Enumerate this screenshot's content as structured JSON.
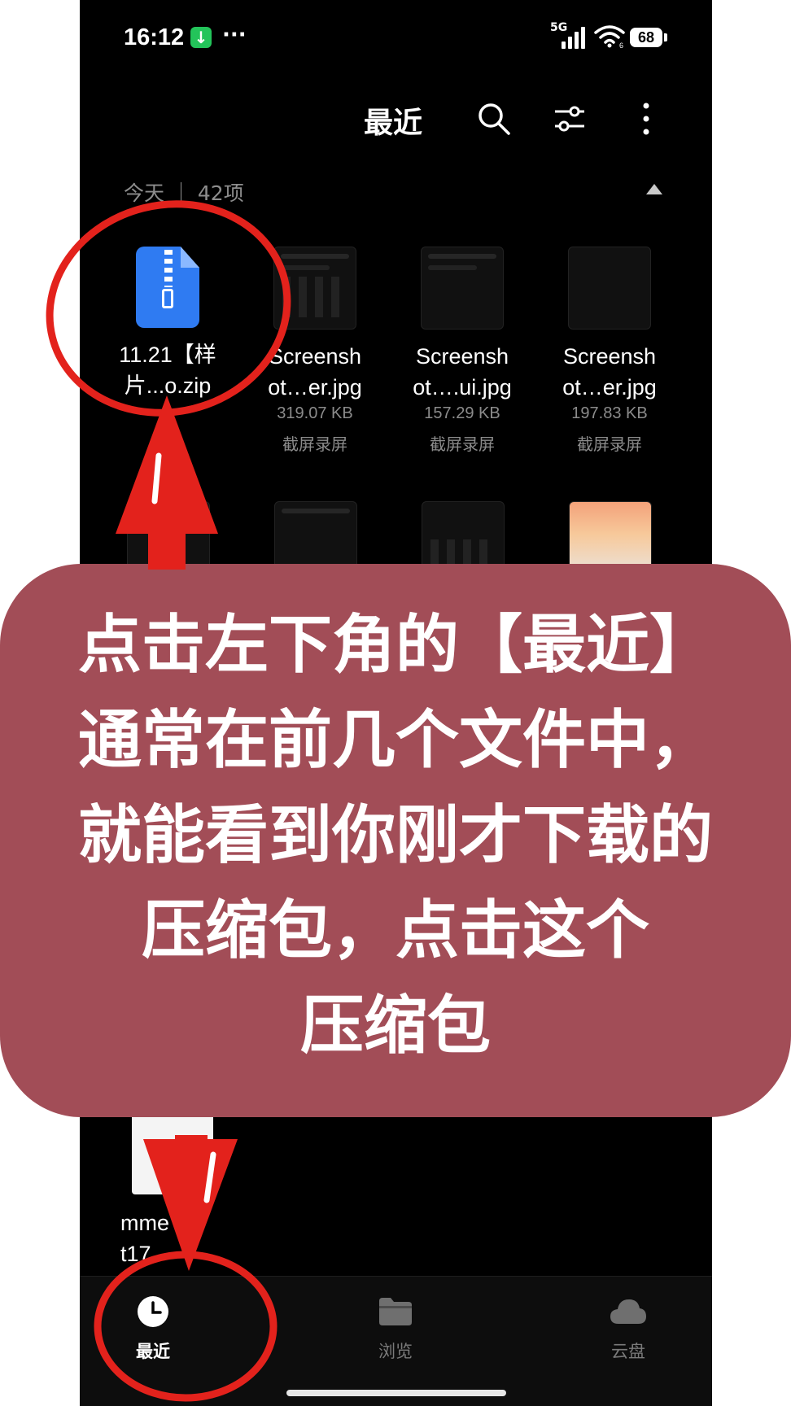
{
  "status_bar": {
    "time": "16:12",
    "download_badge": "↓",
    "more_dots": "···",
    "network": "5G",
    "wifi_sub": "6",
    "battery": "68"
  },
  "header": {
    "title": "最近",
    "search_icon": "search-icon",
    "filter_icon": "sliders-icon",
    "more_icon": "more-vertical-icon"
  },
  "section": {
    "label": "今天 ｜ 42项"
  },
  "files": [
    {
      "name_line1": "11.21【样",
      "name_line2": "片...o.zip",
      "size": "",
      "source": ""
    },
    {
      "name_line1": "Screensh",
      "name_line2": "ot…er.jpg",
      "size": "319.07 KB",
      "source": "截屏录屏"
    },
    {
      "name_line1": "Screensh",
      "name_line2": "ot….ui.jpg",
      "size": "157.29 KB",
      "source": "截屏录屏"
    },
    {
      "name_line1": "Screensh",
      "name_line2": "ot…er.jpg",
      "size": "197.83 KB",
      "source": "截屏录屏"
    }
  ],
  "partial_file": {
    "name_line1": "mme  or",
    "name_line2": "t17"
  },
  "banner": {
    "lines": [
      "点击左下角的【最近】",
      "通常在前几个文件中，",
      "就能看到你刚才下载的",
      "压缩包，点击这个",
      "压缩包"
    ]
  },
  "bottom_nav": [
    {
      "label": "最近",
      "icon": "clock-icon",
      "active": true
    },
    {
      "label": "浏览",
      "icon": "folder-icon",
      "active": false
    },
    {
      "label": "云盘",
      "icon": "cloud-icon",
      "active": false
    }
  ],
  "colors": {
    "background": "#000000",
    "banner": "#a24d57",
    "annotation_red": "#e3221c",
    "zip_blue": "#2f7bf2"
  }
}
